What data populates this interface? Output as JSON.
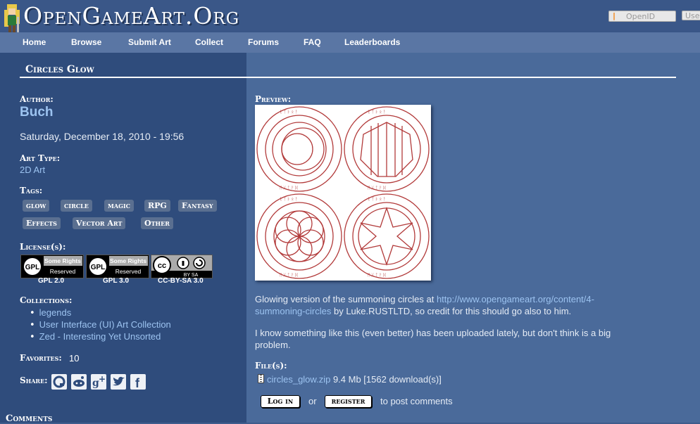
{
  "site": {
    "logo_text": "OpenGameArt.Org",
    "openid_label": "OpenID",
    "user_placeholder": "User"
  },
  "nav": [
    "Home",
    "Browse",
    "Submit Art",
    "Collect",
    "Forums",
    "FAQ",
    "Leaderboards"
  ],
  "art": {
    "title": "Circles Glow",
    "author_label": "Author:",
    "author": "Buch",
    "date": "Saturday, December 18, 2010 - 19:56",
    "art_type_label": "Art Type:",
    "art_type": "2D Art",
    "tags_label": "Tags:",
    "tags": [
      "glow",
      "circle",
      "magic",
      "RPG",
      "Fantasy",
      "Effects",
      "Vector Art",
      "Other"
    ],
    "license_label": "License(s):",
    "licenses": [
      {
        "badge_top": "Some Rights",
        "badge_bottom": "Reserved",
        "badge_logo": "GPL",
        "caption": "GPL 2.0"
      },
      {
        "badge_top": "Some Rights",
        "badge_bottom": "Reserved",
        "badge_logo": "GPL",
        "caption": "GPL 3.0"
      },
      {
        "badge_logo": "cc",
        "badge_bottom": "BY    SA",
        "caption": "CC-BY-SA 3.0"
      }
    ],
    "collections_label": "Collections:",
    "collections": [
      "legends",
      "User Interface (UI) Art Collection",
      "Zed - Interesting Yet Unsorted"
    ],
    "favorites_label": "Favorites:",
    "favorites": "10",
    "share_label": "Share:",
    "share_icons": [
      "openshare-icon",
      "reddit-icon",
      "google-plus-icon",
      "twitter-icon",
      "facebook-icon"
    ],
    "preview_label": "Preview:",
    "desc_p1_prefix": "Glowing version of the summoning circles at ",
    "desc_p1_link_a": "http://www.opengameart.org/content/4-",
    "desc_p1_link_b": "summoning-circles",
    "desc_p1_suffix": " by Luke.RUSTLTD, so credit for this should go also to him.",
    "desc_p2_a": "I know something like this (even better) has been uploaded lately, but don't think is a big",
    "desc_p2_b": "problem.",
    "files_label": "File(s):",
    "file_name": "circles_glow.zip",
    "file_info": "9.4 Mb [1562 download(s)]"
  },
  "comments": {
    "label": "Comments",
    "login_btn": "Log in",
    "or_text": "or",
    "register_btn": "register",
    "suffix": "to post comments"
  },
  "colors": {
    "link": "#9cc3f0",
    "left_panel": "#2f4c7c",
    "right_panel": "#4a6a9a",
    "nav": "#5a76a4"
  }
}
